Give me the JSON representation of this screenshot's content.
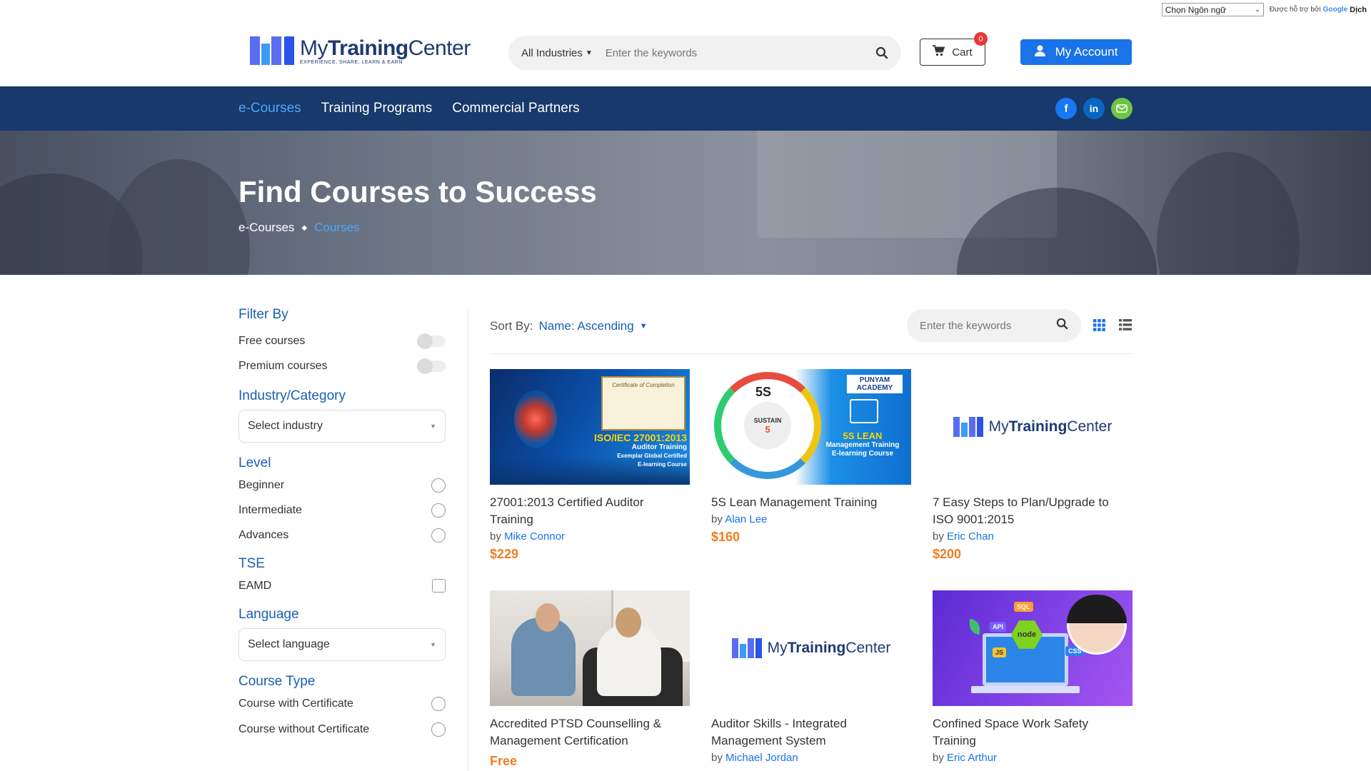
{
  "translate": {
    "select_label": "Chọn Ngôn ngữ",
    "powered_by": "Được hỗ trợ bởi",
    "google": "Google",
    "translate_word": "Dịch"
  },
  "header": {
    "logo": {
      "name_light": "My",
      "name_bold": "Training",
      "name_rest": "Center",
      "tagline": "EXPERIENCE, SHARE, LEARN & EARN"
    },
    "search": {
      "industry_label": "All Industries",
      "placeholder": "Enter the keywords"
    },
    "cart": {
      "label": "Cart",
      "count": "0"
    },
    "account_label": "My Account"
  },
  "nav": {
    "items": [
      {
        "label": "e-Courses",
        "active": true
      },
      {
        "label": "Training Programs",
        "active": false
      },
      {
        "label": "Commercial Partners",
        "active": false
      }
    ],
    "social": [
      "facebook-icon",
      "linkedin-icon",
      "mail-icon"
    ]
  },
  "hero": {
    "title": "Find Courses to Success",
    "breadcrumb": [
      "e-Courses",
      "Courses"
    ]
  },
  "sidebar": {
    "filter_by": {
      "heading": "Filter By",
      "options": [
        "Free courses",
        "Premium courses"
      ]
    },
    "industry": {
      "heading": "Industry/Category",
      "placeholder": "Select industry"
    },
    "level": {
      "heading": "Level",
      "options": [
        "Beginner",
        "Intermediate",
        "Advances"
      ]
    },
    "tse": {
      "heading": "TSE",
      "options": [
        "EAMD"
      ]
    },
    "language": {
      "heading": "Language",
      "placeholder": "Select language"
    },
    "course_type": {
      "heading": "Course Type",
      "options": [
        "Course with Certificate",
        "Course without Certificate"
      ]
    }
  },
  "toolbar": {
    "sort_label": "Sort By:",
    "sort_value": "Name: Ascending",
    "search_placeholder": "Enter the keywords"
  },
  "courses": [
    {
      "title": "27001:2013 Certified Auditor Training",
      "by": "by",
      "author": "Mike Connor",
      "price": "$229",
      "thumb": {
        "cert": "Certificate of Completion",
        "big": "ISO/IEC 27001:2013",
        "line1": "Auditor Training",
        "line2": "Exemplar Global Certified",
        "line3": "E-learning Course"
      }
    },
    {
      "title": "5S Lean Management Training",
      "by": "by",
      "author": "Alan Lee",
      "price": "$160",
      "thumb": {
        "brand": "PUNYAM ACADEMY",
        "center": "SUSTAIN",
        "center_num": "5",
        "big": "5S LEAN",
        "line1": "Management Training",
        "line2": "E-learning Course",
        "five_s": "5S"
      }
    },
    {
      "title": "7 Easy Steps to Plan/Upgrade to ISO 9001:2015",
      "by": "by",
      "author": "Eric Chan",
      "price": "$200"
    },
    {
      "title": "Accredited PTSD Counselling & Management Certification",
      "by": "",
      "author": "",
      "price": "Free"
    },
    {
      "title": "Auditor Skills - Integrated Management System",
      "by": "by",
      "author": "Michael Jordan",
      "price": ""
    },
    {
      "title": "Confined Space Work Safety Training",
      "by": "by",
      "author": "Eric Arthur",
      "price": "",
      "thumb": {
        "node": "node",
        "api": "API",
        "sql": "SQL",
        "css": "CSS",
        "js": "JS"
      }
    }
  ],
  "colors": {
    "nav_bg": "#17396b",
    "accent": "#1a73e8",
    "heading_blue": "#1a5fb4",
    "price_orange": "#f07d22"
  }
}
